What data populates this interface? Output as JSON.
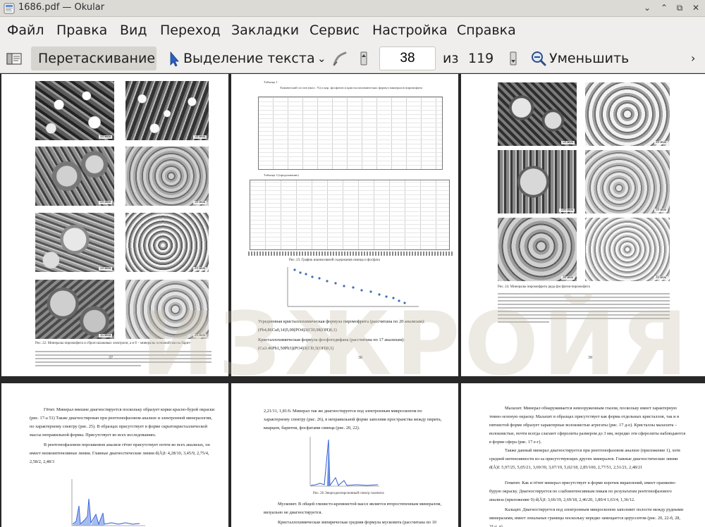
{
  "window": {
    "title": "1686.pdf  — Okular",
    "buttons": {
      "minimize": "⌄",
      "maximize": "⌃",
      "restore": "⧉",
      "close": "✕"
    }
  },
  "menu": [
    "Файл",
    "Правка",
    "Вид",
    "Переход",
    "Закладки",
    "Сервис",
    "Настройка",
    "Справка"
  ],
  "toolbar": {
    "browse_label": "Перетаскивание",
    "select_text_label": "Выделение текста",
    "page_current": "38",
    "page_of": "из",
    "page_total": "119",
    "zoom_out_label": "Уменьшить"
  },
  "watermark": "ИЗЖРОЙЯ",
  "pages": {
    "p37": {
      "number": "37",
      "scale_labels": [
        "50 мкм",
        "50 мкм",
        "50 мкм",
        "50 мкм",
        "50 мкм",
        "20 мкм",
        "15 мкм",
        "20 мкм"
      ],
      "caption": "Рис. 22. Минералы пиромофита и сброп-шлаковых электроон, а и б – минералы основной массы барит-"
    },
    "p38": {
      "number": "38",
      "table_title": "Таблица 1",
      "table_caption": "Химический состав (масс. %) и кор. фосфатов и кристаллохимических формул минералов пиромофита",
      "table3_title": "Таблица 3 (продолжение)",
      "chart_title": "Рис. 23. График взаимосвязей содержания свинца и фосфата",
      "formula_1": "Усредненная кристаллохимическая формула пиромофрита (рассчитана по 20 анализам):",
      "formula_2": "(Pb4,86Ca0,14)5,00(PO4)3(Cl0,98(OH)0,1)",
      "formula_3": "Кристаллохимическая формула фосфогедифана (рассчитана по 17 анализам):",
      "formula_4": "(Ca3.46Pb1,50Pb3)(PO4)3(Cl0,5(OH)0,5)"
    },
    "p39": {
      "number": "39",
      "scale_labels": [
        "50 мкм",
        "20 мкм",
        "100 мкм",
        "50 мкм",
        "30 мкм",
        "20 мкм"
      ],
      "caption": "Рис. 24. Минералы пиромофрита ряда фосфатов-пиромофита"
    },
    "p40": {
      "paragraph_1": "Гётит. Минерал внешне диагностируется поскольку образует корки красно-бурой окраски (рис. 17-а 51) Также диагностирован при рентгенофазовом анализе и электронной минералогии, по характерному спектру (рис. 25). В образцах присутствует в форме скрытокристаллической массы неправильной формы. Присутствует во всех исследованиях.",
      "paragraph_2": "В рентгенофазовом порошковом анализе гётит присутствует почти во всех анализах, он имеет низкоинтенсивные линии. Главные диагностические линии d(Å)I: 4,28/10, 3,45/9, 2,75/4, 2,58/2, 2,48/3"
    },
    "p41": {
      "paragraph_1": "2,21/11, 1,81/6. Минерал так же диагностируется под электронным микроскопом по характерному спектру (рис. 26), в неправильной форме заполняя пространства между пирита, кварцем, баритом, фосфатами свинца (рис. 20, 22).",
      "figure_caption": "Рис. 26 Энергодисперсионный спектр галенита",
      "paragraph_2": "Мусковит. В общей глинисто-кремнистой массе является второстепенным минералом, визуально не диагностируется.",
      "paragraph_3": "Кристаллохимическая эмпирическая средняя формула мусковита (рассчитана по 10"
    },
    "p42": {
      "paragraph_1": "Малахит. Минерал обнаруживается невооруженным глазом, поскольку имеет характерную темно-зеленую окраску. Малахит в образцах присутствует как форма отдельных кристаллов, так и в пятнистой форме образует характерные волокнистые агрегаты (рис. 17 д-е). Кристаллы малахита – волокнистые, почти всегда слагают сферолиты размером до 3 мм, нередко эти сферолиты наблюдаются в форме сфера (рис. 17 е-г).",
      "paragraph_2": "Также данный минерал диагностируется при рентгенофазовом анализе (приложение 1), хотя средней интенсивности из-за присутствующих других минералов. Главные диагностические линии d(Å)I: 5,97/25, 5,05/21, 3,69/39, 3,07/19, 5,02/18, 2,85/100, 2,77/51, 2,51/21, 2,48/21",
      "paragraph_3": "Гематит. Как и гётит минерал присутствует в форме корочек вкраплений, имеет оранжево-бурую окраску. Диагностируется по слабоинтенсивным пикам по результатам рентгенофазового анализа (приложение 9) d(Å)I: 3,66/19, 2,69/18, 2,46/20, 1,80/4 1,63/4, 1,36/12.",
      "paragraph_4": "Кальцит. Диагностируется под электронным микроскопом заполняет полости между рудными минералами, имеет зональные границы поскольку нередко замещается церусситом (рис. 20, 22-б, 28, 31-г, д)."
    }
  }
}
